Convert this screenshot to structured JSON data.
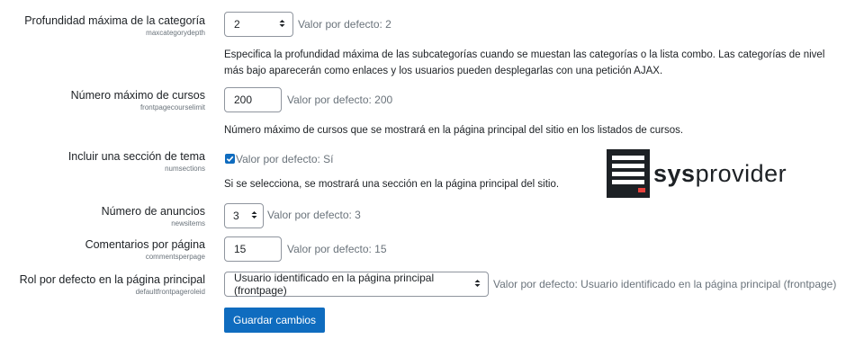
{
  "settings": [
    {
      "label": "Profundidad máxima de la categoría",
      "key": "maxcategorydepth",
      "control": "select",
      "value": "2",
      "default": "Valor por defecto: 2",
      "description": "Especifica la profundidad máxima de las subcategorías cuando se muestan las categorías o la lista combo. Las categorías de nivel más bajo aparecerán como enlaces y los usuarios pueden desplegarlas con una petición AJAX."
    },
    {
      "label": "Número máximo de cursos",
      "key": "frontpagecourselimit",
      "control": "input",
      "value": "200",
      "default": "Valor por defecto: 200",
      "description": "Número máximo de cursos que se mostrará en la página principal del sitio en los listados de cursos."
    },
    {
      "label": "Incluir una sección de tema",
      "key": "numsections",
      "control": "checkbox",
      "checked": true,
      "default": "Valor por defecto: Sí",
      "description": "Si se selecciona, se mostrará una sección en la página principal del sitio."
    },
    {
      "label": "Número de anuncios",
      "key": "newsitems",
      "control": "select",
      "value": "3",
      "default": "Valor por defecto: 3"
    },
    {
      "label": "Comentarios por página",
      "key": "commentsperpage",
      "control": "input",
      "value": "15",
      "default": "Valor por defecto: 15"
    },
    {
      "label": "Rol por defecto en la página principal",
      "key": "defaultfrontpageroleid",
      "control": "select",
      "value": "Usuario identificado en la página principal (frontpage)",
      "default": "Valor por defecto: Usuario identificado en la página principal (frontpage)"
    }
  ],
  "save_button": "Guardar cambios",
  "watermark": {
    "text_bold": "sys",
    "text_light": "provider"
  },
  "colors": {
    "primary": "#0f6cbf",
    "muted": "#6a737b",
    "text": "#1d2125"
  }
}
